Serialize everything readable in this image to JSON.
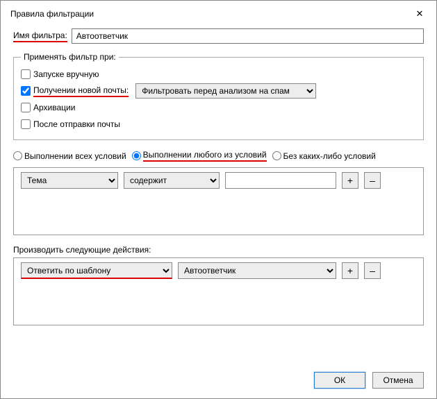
{
  "window": {
    "title": "Правила фильтрации"
  },
  "filterName": {
    "label": "Имя фильтра:",
    "value": "Автоответчик"
  },
  "applyGroup": {
    "legend": "Применять фильтр при:",
    "manual": {
      "label": "Запуске вручную",
      "checked": false
    },
    "receive": {
      "label": "Получении новой почты:",
      "checked": true,
      "mode": "Фильтровать перед анализом на спам"
    },
    "archive": {
      "label": "Архивации",
      "checked": false
    },
    "afterSend": {
      "label": "После отправки почты",
      "checked": false
    }
  },
  "match": {
    "all": "Выполнении всех условий",
    "any": "Выполнении любого из условий",
    "none": "Без каких-либо условий",
    "selected": "any"
  },
  "condition": {
    "field": "Тема",
    "op": "содержит",
    "value": "",
    "add": "+",
    "remove": "–"
  },
  "actionsLabel": "Производить следующие действия:",
  "action": {
    "type": "Ответить по шаблону",
    "param": "Автоответчик",
    "add": "+",
    "remove": "–"
  },
  "buttons": {
    "ok": "ОК",
    "cancel": "Отмена"
  }
}
